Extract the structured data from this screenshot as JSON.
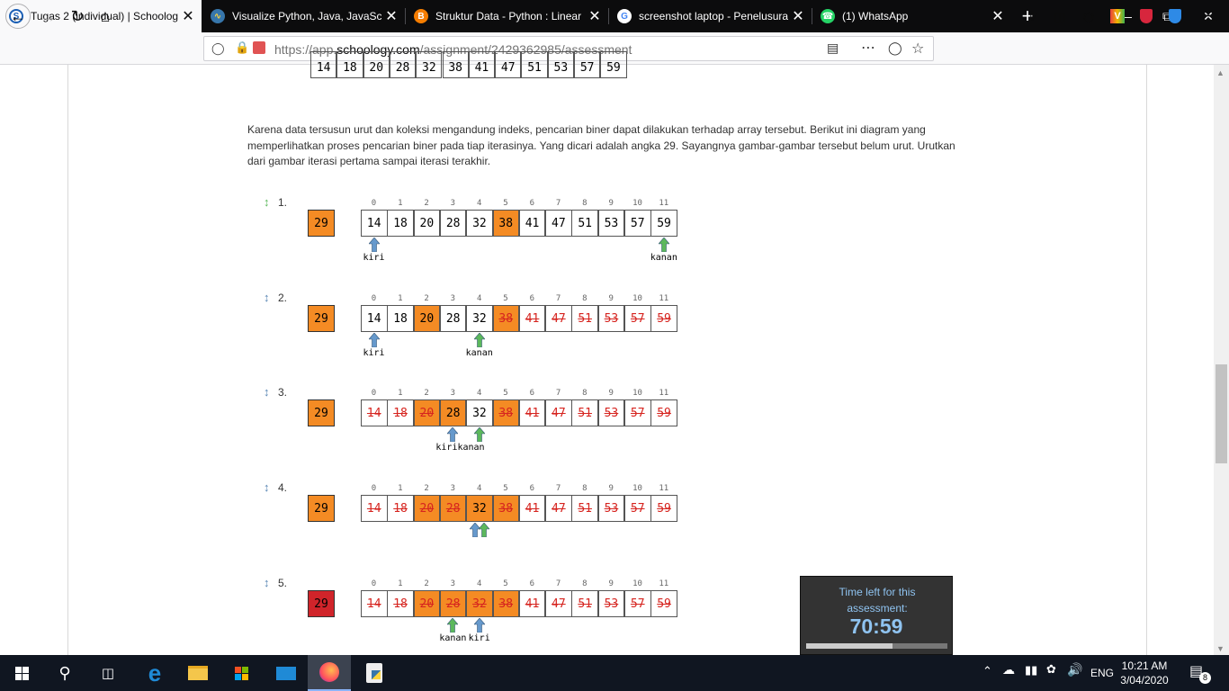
{
  "tabs": [
    {
      "title": "Tugas 2 (individual) | Schoology",
      "icon": "schoology-icon",
      "active": true
    },
    {
      "title": "Visualize Python, Java, JavaScript",
      "icon": "python-icon"
    },
    {
      "title": "Struktur Data - Python : Linear",
      "icon": "blogger-icon"
    },
    {
      "title": "screenshot laptop - Penelusuran",
      "icon": "google-icon"
    },
    {
      "title": "(1) WhatsApp",
      "icon": "whatsapp-icon"
    }
  ],
  "new_tab": "+",
  "url": {
    "prefix": "https://app.",
    "domain": "schoology.com",
    "path": "/assignment/2429362985/assessment"
  },
  "intro": "Karena data tersusun urut dan koleksi mengandung indeks, pencarian biner dapat dilakukan terhadap array tersebut. Berikut ini diagram yang memperlihatkan proses pencarian biner pada tiap iterasinya. Yang dicari adalah angka 29. Sayangnya gambar-gambar tersebut belum urut. Urutkan dari gambar iterasi pertama sampai iterasi terakhir.",
  "top_values": [
    "14",
    "18",
    "20",
    "28",
    "32",
    "38",
    "41",
    "47",
    "51",
    "53",
    "57",
    "59"
  ],
  "indices": [
    "0",
    "1",
    "2",
    "3",
    "4",
    "5",
    "6",
    "7",
    "8",
    "9",
    "10",
    "11"
  ],
  "search_value": "29",
  "items": [
    {
      "num": "1.",
      "target_color": "#f48b24",
      "sort_color": "#5cb85c",
      "values": [
        "14",
        "18",
        "20",
        "28",
        "32",
        "38",
        "41",
        "47",
        "51",
        "53",
        "57",
        "59"
      ],
      "orange": [
        5
      ],
      "strike": [],
      "kiri": {
        "label": "kiri",
        "at": 0
      },
      "kanan": {
        "label": "kanan",
        "at": 11
      }
    },
    {
      "num": "2.",
      "target_color": "#f48b24",
      "sort_color": "#5b88b5",
      "values": [
        "14",
        "18",
        "20",
        "28",
        "32",
        "38",
        "41",
        "47",
        "51",
        "53",
        "57",
        "59"
      ],
      "orange": [
        2,
        5
      ],
      "strike": [
        5,
        6,
        7,
        8,
        9,
        10,
        11
      ],
      "kiri": {
        "label": "kiri",
        "at": 0
      },
      "kanan": {
        "label": "kanan",
        "at": 4
      }
    },
    {
      "num": "3.",
      "target_color": "#f48b24",
      "sort_color": "#5b88b5",
      "values": [
        "14",
        "18",
        "20",
        "28",
        "32",
        "38",
        "41",
        "47",
        "51",
        "53",
        "57",
        "59"
      ],
      "orange": [
        2,
        3,
        5
      ],
      "strike": [
        0,
        1,
        2,
        5,
        6,
        7,
        8,
        9,
        10,
        11
      ],
      "kiri": {
        "label": "kiri",
        "at": 3
      },
      "kanan": {
        "label": "kanan",
        "at": 4
      },
      "combined": "kirikanan"
    },
    {
      "num": "4.",
      "target_color": "#f48b24",
      "sort_color": "#5b88b5",
      "values": [
        "14",
        "18",
        "20",
        "28",
        "32",
        "38",
        "41",
        "47",
        "51",
        "53",
        "57",
        "59"
      ],
      "orange": [
        2,
        3,
        4,
        5
      ],
      "strike": [
        0,
        1,
        2,
        3,
        5,
        6,
        7,
        8,
        9,
        10,
        11
      ],
      "kiri": {
        "label": "",
        "at": 4
      },
      "kanan": {
        "label": "",
        "at": 4
      }
    },
    {
      "num": "5.",
      "target_color": "#d0242a",
      "sort_color": "#5b88b5",
      "values": [
        "14",
        "18",
        "20",
        "28",
        "32",
        "38",
        "41",
        "47",
        "51",
        "53",
        "57",
        "59"
      ],
      "orange": [
        2,
        3,
        4,
        5
      ],
      "strike": [
        0,
        1,
        2,
        3,
        4,
        5,
        6,
        7,
        8,
        9,
        10,
        11
      ],
      "kiri": {
        "label": "kiri",
        "at": 4
      },
      "kanan": {
        "label": "kanan",
        "at": 3
      }
    }
  ],
  "timer": {
    "label": "Time left for this assessment:",
    "value": "70:59",
    "progress": 0.61
  },
  "clock": {
    "time": "10:21 AM",
    "date": "3/04/2020"
  },
  "lang": "ENG",
  "notif_count": "8",
  "colors": {
    "kiri": "#6699cc",
    "kanan": "#5cb85c",
    "strike": "#d6241f",
    "orange": "#f48b24"
  }
}
